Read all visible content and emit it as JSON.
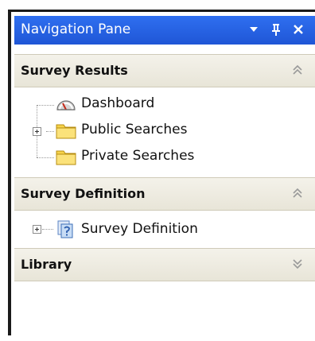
{
  "pane": {
    "title": "Navigation Pane",
    "title_bg": "#2a63e6"
  },
  "sections": {
    "survey_results": {
      "label": "Survey Results",
      "items": {
        "dashboard": "Dashboard",
        "public_searches": "Public Searches",
        "private_searches": "Private Searches"
      }
    },
    "survey_definition": {
      "label": "Survey Definition",
      "items": {
        "survey_definition": "Survey Definition"
      }
    },
    "library": {
      "label": "Library"
    }
  },
  "icons": {
    "dropdown": "chevron-down-icon",
    "pin": "pin-icon",
    "close": "close-icon",
    "collapse": "double-chevron-up-icon",
    "expand": "double-chevron-down-icon",
    "dashboard": "gauge-icon",
    "folder": "folder-icon",
    "document": "survey-document-icon"
  }
}
